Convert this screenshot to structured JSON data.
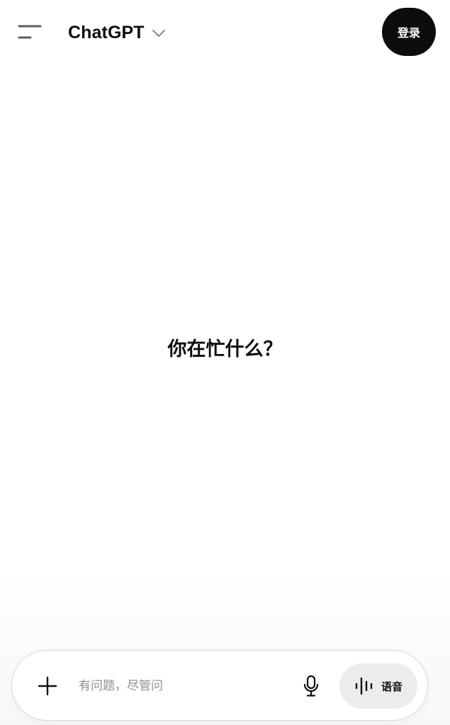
{
  "header": {
    "model_name": "ChatGPT",
    "login_label": "登录",
    "menu_icon": "menu-icon",
    "chevron_icon": "chevron-down-icon"
  },
  "main": {
    "greeting": "你在忙什么？"
  },
  "composer": {
    "placeholder": "有问题，尽管问",
    "value": "",
    "attach_icon": "plus-icon",
    "mic_icon": "mic-icon",
    "voice_icon": "waveform-icon",
    "voice_label": "语音"
  },
  "colors": {
    "primary_button": "#0d0d0d",
    "voice_button_bg": "#ececec",
    "placeholder": "#8e8e8e"
  }
}
